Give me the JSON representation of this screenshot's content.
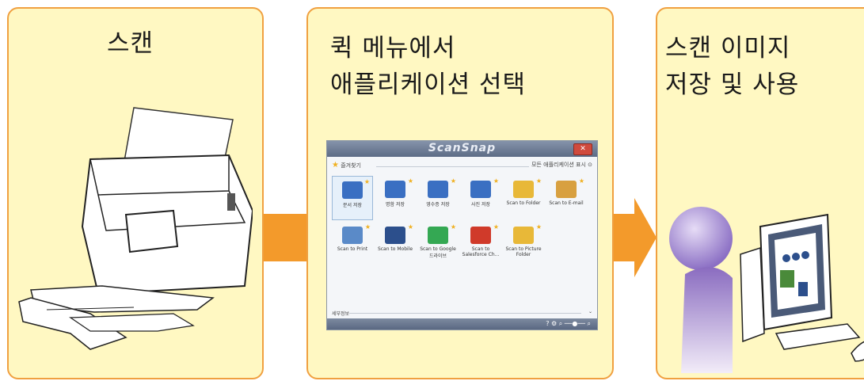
{
  "steps": [
    {
      "title_line1": "스캔",
      "title_line2": ""
    },
    {
      "title_line1": "퀵 메뉴에서",
      "title_line2": "애플리케이션 선택"
    },
    {
      "title_line1": "스캔 이미지",
      "title_line2": "저장 및 사용"
    }
  ],
  "quick_menu": {
    "brand": "ScanSnap",
    "favorites_label": "즐겨찾기",
    "show_all_label": "모든 애플리케이션 표시",
    "details_label": "세부정보",
    "apps": [
      {
        "label": "문서 저장",
        "color": "#3a6fc2",
        "selected": true
      },
      {
        "label": "명함 저장",
        "color": "#3a6fc2",
        "selected": false
      },
      {
        "label": "영수증 저장",
        "color": "#3a6fc2",
        "selected": false
      },
      {
        "label": "사진 저장",
        "color": "#3a6fc2",
        "selected": false
      },
      {
        "label": "Scan to Folder",
        "color": "#e8b838",
        "selected": false
      },
      {
        "label": "Scan to E-mail",
        "color": "#d8a040",
        "selected": false
      },
      {
        "label": "Scan to Print",
        "color": "#5a8ac8",
        "selected": false
      },
      {
        "label": "Scan to Mobile",
        "color": "#2c4f8c",
        "selected": false
      },
      {
        "label": "Scan to Google 드라이브",
        "color": "#34a853",
        "selected": false
      },
      {
        "label": "Scan to Salesforce Ch...",
        "color": "#d03a2a",
        "selected": false
      },
      {
        "label": "Scan to Picture Folder",
        "color": "#e8b838",
        "selected": false
      }
    ]
  },
  "colors": {
    "panel_bg": "#fff8c2",
    "panel_border": "#f0a040",
    "arrow": "#f39a2b"
  }
}
